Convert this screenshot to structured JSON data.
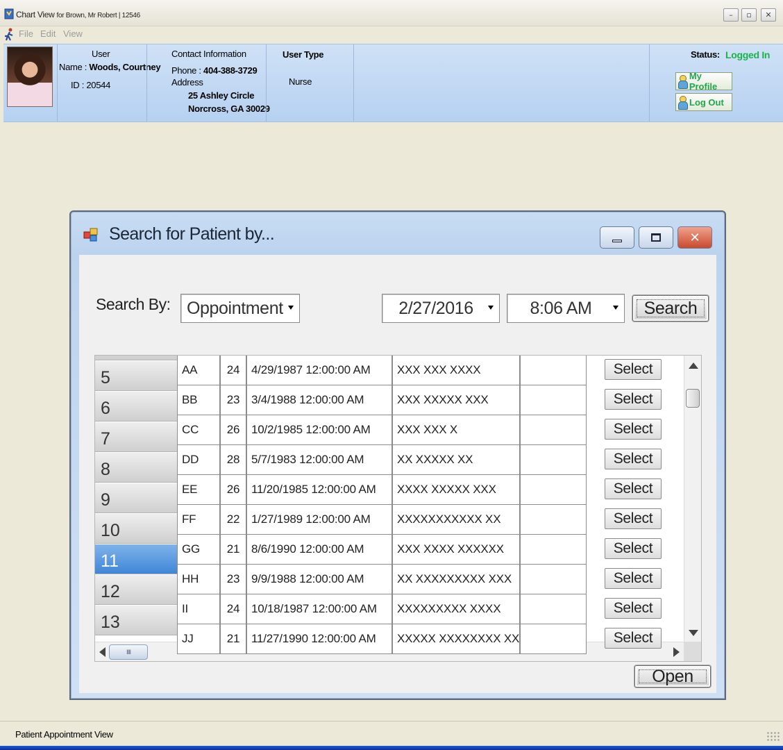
{
  "window": {
    "title": "Chart View",
    "subtitle": "for Brown, Mr Robert | 12546",
    "controls": {
      "minimize": "–",
      "maximize": "▫",
      "close": "✕"
    }
  },
  "menu": {
    "items": [
      "File",
      "Edit",
      "View"
    ]
  },
  "user": {
    "heading": "User",
    "name_label": "Name :",
    "name": "Woods, Courtney",
    "id_label": "ID :",
    "id": "20544"
  },
  "contact": {
    "heading": "Contact Information",
    "phone_label": "Phone :",
    "phone": "404-388-3729",
    "address_label": "Address",
    "address_line1": "25 Ashley Circle",
    "address_line2": "Norcross, GA 30029"
  },
  "user_type": {
    "heading": "User Type",
    "value": "Nurse"
  },
  "status": {
    "label": "Status:",
    "value": "Logged In",
    "color": "#1ab34a"
  },
  "side_buttons": {
    "profile": "My Profile",
    "logout": "Log Out"
  },
  "dialog": {
    "title": "Search for Patient by...",
    "search_by_label": "Search By:",
    "search_by_value": "Oppointment",
    "date_value": "2/27/2016",
    "time_value": "8:06 AM",
    "search_button": "Search",
    "open_button": "Open",
    "select_label": "Select",
    "row_numbers": [
      "5",
      "6",
      "7",
      "8",
      "9",
      "10",
      "11",
      "12",
      "13"
    ],
    "selected_row": "11",
    "rows": [
      {
        "initials": "AA",
        "age": "24",
        "datetime": "4/29/1987 12:00:00 AM",
        "masked": "XXX XXX XXXX"
      },
      {
        "initials": "BB",
        "age": "23",
        "datetime": "3/4/1988 12:00:00 AM",
        "masked": "XXX XXXXX XXX"
      },
      {
        "initials": "CC",
        "age": "26",
        "datetime": "10/2/1985 12:00:00 AM",
        "masked": "XXX XXX X"
      },
      {
        "initials": "DD",
        "age": "28",
        "datetime": "5/7/1983 12:00:00 AM",
        "masked": "XX XXXXX XX"
      },
      {
        "initials": "EE",
        "age": "26",
        "datetime": "11/20/1985 12:00:00 AM",
        "masked": "XXXX XXXXX XXX"
      },
      {
        "initials": "FF",
        "age": "22",
        "datetime": "1/27/1989 12:00:00 AM",
        "masked": "XXXXXXXXXXX XX"
      },
      {
        "initials": "GG",
        "age": "21",
        "datetime": "8/6/1990 12:00:00 AM",
        "masked": "XXX XXXX XXXXXX"
      },
      {
        "initials": "HH",
        "age": "23",
        "datetime": "9/9/1988 12:00:00 AM",
        "masked": "XX XXXXXXXXX XXX"
      },
      {
        "initials": "II",
        "age": "24",
        "datetime": "10/18/1987 12:00:00 AM",
        "masked": "XXXXXXXXX XXXX"
      },
      {
        "initials": "JJ",
        "age": "21",
        "datetime": "11/27/1990 12:00:00 AM",
        "masked": "XXXXX XXXXXXXX XX"
      }
    ]
  },
  "statusbar": {
    "text": "Patient Appointment View"
  },
  "colors": {
    "accent_blue": "#3f86d7",
    "header_band": "#b6d1f1",
    "status_green": "#1ab34a"
  }
}
